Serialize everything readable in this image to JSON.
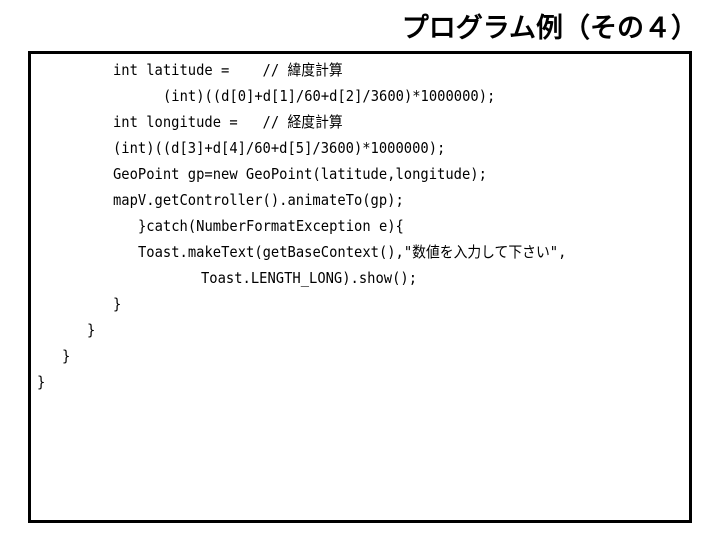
{
  "slide": {
    "title": "プログラム例（その４）"
  },
  "code": {
    "lines": [
      {
        "indent": 6,
        "text": "int latitude =    // 緯度計算"
      },
      {
        "indent": 10,
        "text": "(int)((d[0]+d[1]/60+d[2]/3600)*1000000);"
      },
      {
        "indent": 6,
        "text": "int longitude =   // 経度計算"
      },
      {
        "indent": 6,
        "text": "(int)((d[3]+d[4]/60+d[5]/3600)*1000000);"
      },
      {
        "indent": 6,
        "text": "GeoPoint gp=new GeoPoint(latitude,longitude);"
      },
      {
        "indent": 6,
        "text": "mapV.getController().animateTo(gp);"
      },
      {
        "indent": 8,
        "text": "}catch(NumberFormatException e){"
      },
      {
        "indent": 8,
        "text": "Toast.makeText(getBaseContext(),\"数値を入力して下さい\","
      },
      {
        "indent": 13,
        "text": "Toast.LENGTH_LONG).show();"
      },
      {
        "indent": 6,
        "text": "}"
      },
      {
        "indent": 4,
        "text": "}"
      },
      {
        "indent": 2,
        "text": "}"
      },
      {
        "indent": 0,
        "text": "}"
      }
    ]
  }
}
